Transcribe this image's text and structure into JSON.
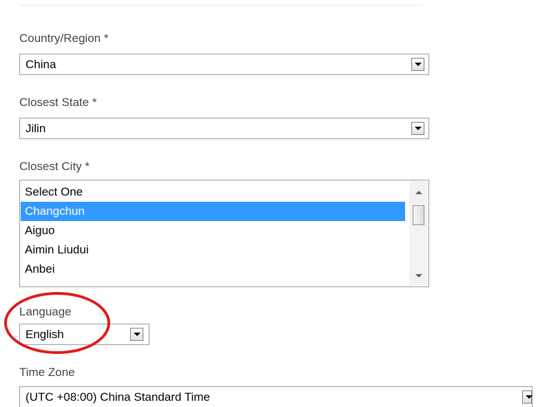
{
  "form": {
    "country": {
      "label": "Country/Region *",
      "value": "China"
    },
    "state": {
      "label": "Closest State *",
      "value": "Jilin"
    },
    "city": {
      "label": "Closest City *",
      "options": [
        "Select One",
        "Changchun",
        "Aiguo",
        "Aimin Liudui",
        "Anbei"
      ],
      "selected": "Changchun"
    },
    "language": {
      "label": "Language",
      "value": "English"
    },
    "timezone": {
      "label": "Time Zone",
      "value": "(UTC +08:00) China Standard Time"
    }
  },
  "annotation": {
    "shape": "ellipse",
    "color": "#e01a1a",
    "target": "language-field"
  },
  "colors": {
    "selection": "#3399ff",
    "label_text": "#444444"
  }
}
